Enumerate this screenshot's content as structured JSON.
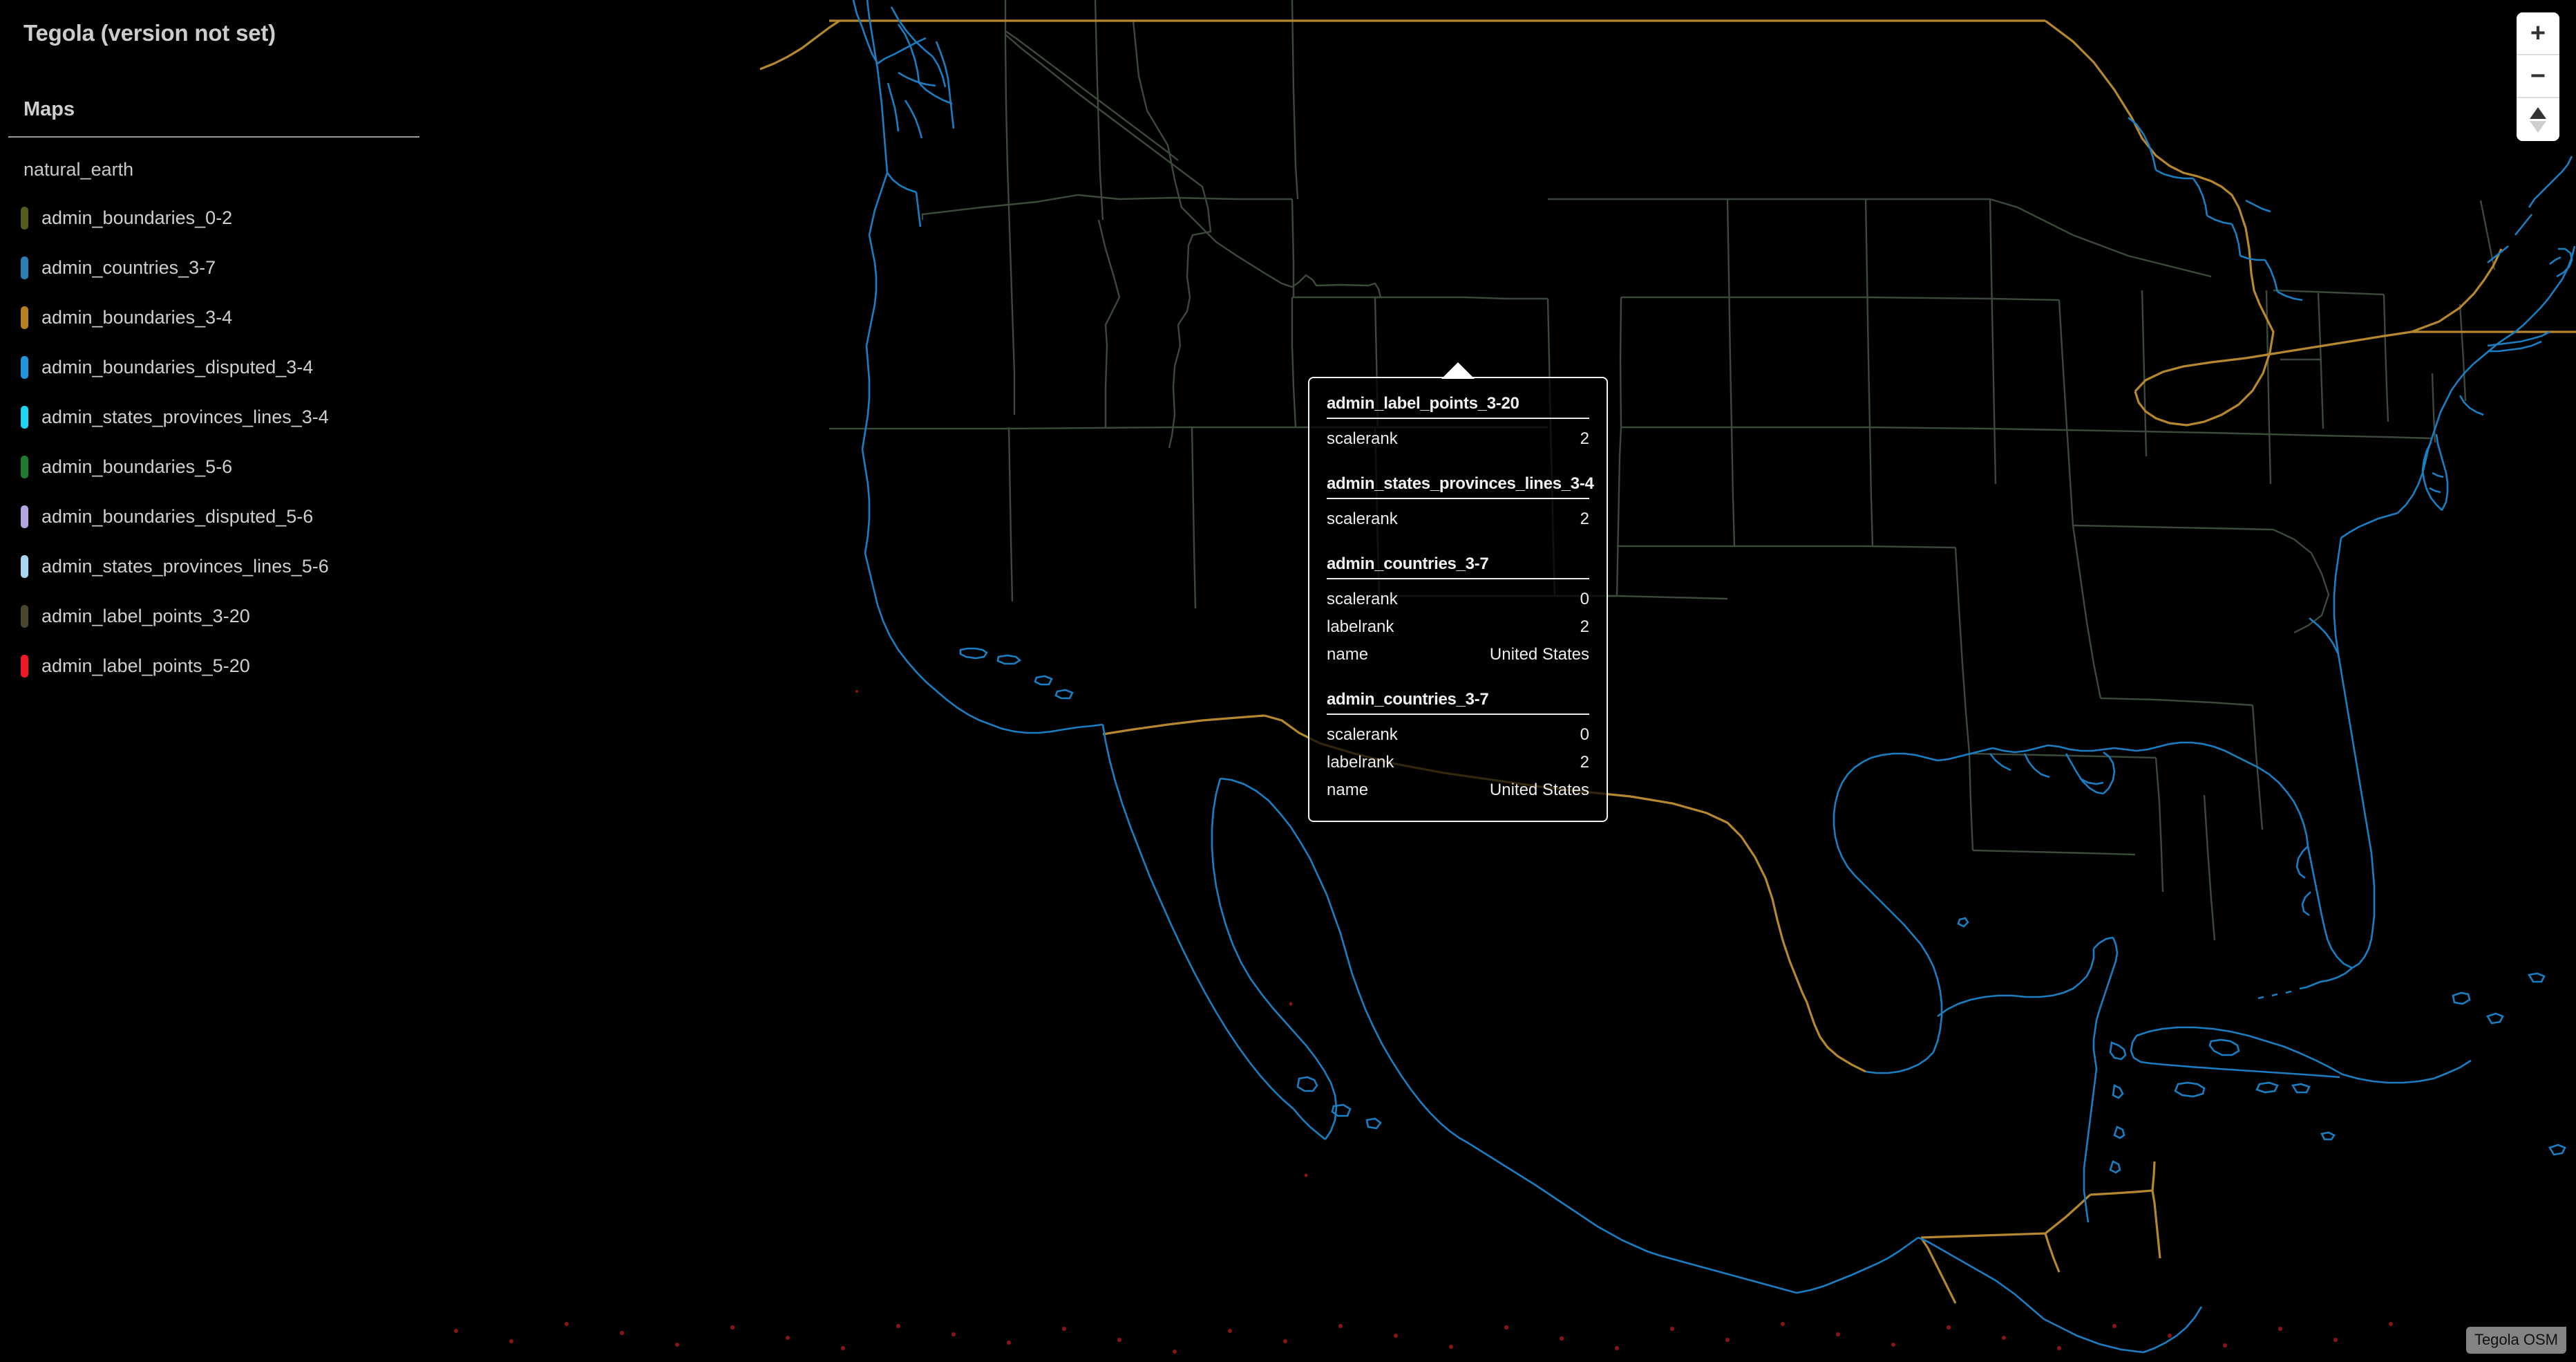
{
  "app": {
    "title": "Tegola (version not set)",
    "background_color": "#000000"
  },
  "sidebar": {
    "heading": "Maps",
    "group_name": "natural_earth",
    "layers": [
      {
        "label": "admin_boundaries_0-2",
        "color": "#555b1f"
      },
      {
        "label": "admin_countries_3-7",
        "color": "#2b7fb5"
      },
      {
        "label": "admin_boundaries_3-4",
        "color": "#b5811f"
      },
      {
        "label": "admin_boundaries_disputed_3-4",
        "color": "#2196dd"
      },
      {
        "label": "admin_states_provinces_lines_3-4",
        "color": "#21d3f0"
      },
      {
        "label": "admin_boundaries_5-6",
        "color": "#1f7a2e"
      },
      {
        "label": "admin_boundaries_disputed_5-6",
        "color": "#b3a6e0"
      },
      {
        "label": "admin_states_provinces_lines_5-6",
        "color": "#a8d6f2"
      },
      {
        "label": "admin_label_points_3-20",
        "color": "#4a472c"
      },
      {
        "label": "admin_label_points_5-20",
        "color": "#ef1a22"
      }
    ]
  },
  "popup": {
    "sections": [
      {
        "title": "admin_label_points_3-20",
        "rows": [
          {
            "key": "scalerank",
            "value": "2"
          }
        ]
      },
      {
        "title": "admin_states_provinces_lines_3-4",
        "rows": [
          {
            "key": "scalerank",
            "value": "2"
          }
        ]
      },
      {
        "title": "admin_countries_3-7",
        "rows": [
          {
            "key": "scalerank",
            "value": "0"
          },
          {
            "key": "labelrank",
            "value": "2"
          },
          {
            "key": "name",
            "value": "United States"
          }
        ]
      },
      {
        "title": "admin_countries_3-7",
        "rows": [
          {
            "key": "scalerank",
            "value": "0"
          },
          {
            "key": "labelrank",
            "value": "2"
          },
          {
            "key": "name",
            "value": "United States"
          }
        ]
      }
    ]
  },
  "map_controls": {
    "zoom_in_label": "+",
    "zoom_out_label": "−",
    "pitch_label": "pitch"
  },
  "attribution": {
    "text": "Tegola OSM"
  },
  "map_style": {
    "coastline_color": "#1b7ec2",
    "country_border_color": "#b5872f",
    "state_border_color": "#3b4a3b",
    "label_point_color": "#8c1510",
    "water_fill": "#000000",
    "land_fill": "#000000"
  }
}
